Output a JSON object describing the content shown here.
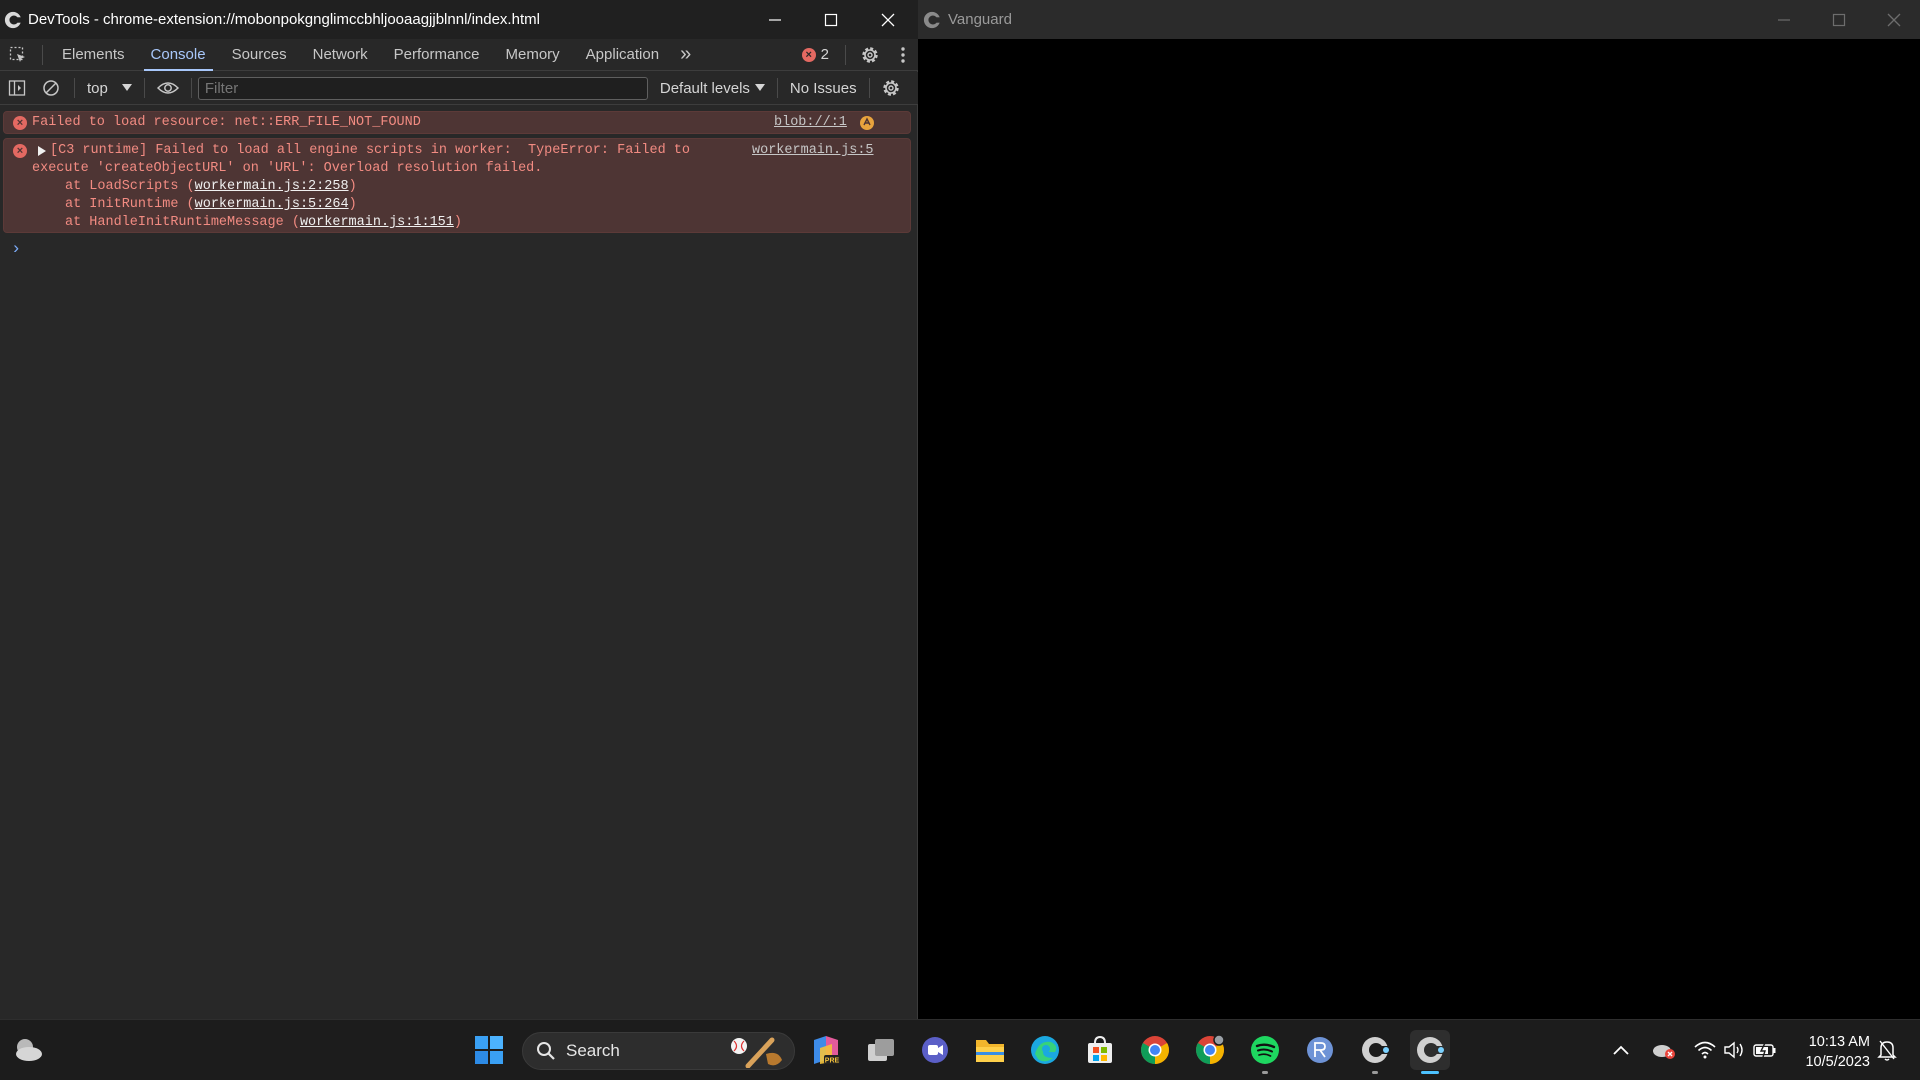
{
  "devtools": {
    "window_title": "DevTools - chrome-extension://mobonpokgnglimccbhljooaagjjblnnl/index.html",
    "tabs": [
      "Elements",
      "Console",
      "Sources",
      "Network",
      "Performance",
      "Memory",
      "Application"
    ],
    "active_tab": "Console",
    "more_tabs_label": "»",
    "error_count": "2",
    "console_toolbar": {
      "context": "top",
      "filter_placeholder": "Filter",
      "levels": "Default levels",
      "issues": "No Issues"
    },
    "messages": [
      {
        "type": "error",
        "text": "Failed to load resource: net::ERR_FILE_NOT_FOUND",
        "source": "blob://:1"
      },
      {
        "type": "error",
        "line1": "[C3 runtime] Failed to load all engine scripts in worker:  TypeError: Failed to",
        "line2": "execute 'createObjectURL' on 'URL': Overload resolution failed.",
        "source": "workermain.js:5",
        "stack": [
          {
            "fn": "at LoadScripts (",
            "loc": "workermain.js:2:258",
            "end": ")"
          },
          {
            "fn": "at InitRuntime (",
            "loc": "workermain.js:5:264",
            "end": ")"
          },
          {
            "fn": "at HandleInitRuntimeMessage (",
            "loc": "workermain.js:1:151",
            "end": ")"
          }
        ]
      }
    ],
    "prompt": "›"
  },
  "vanguard": {
    "window_title": "Vanguard"
  },
  "taskbar": {
    "search_label": "Search",
    "time": "10:13 AM",
    "date": "10/5/2023",
    "spotify_color": "#1ed760",
    "accent_color": "#4cc2ff"
  }
}
